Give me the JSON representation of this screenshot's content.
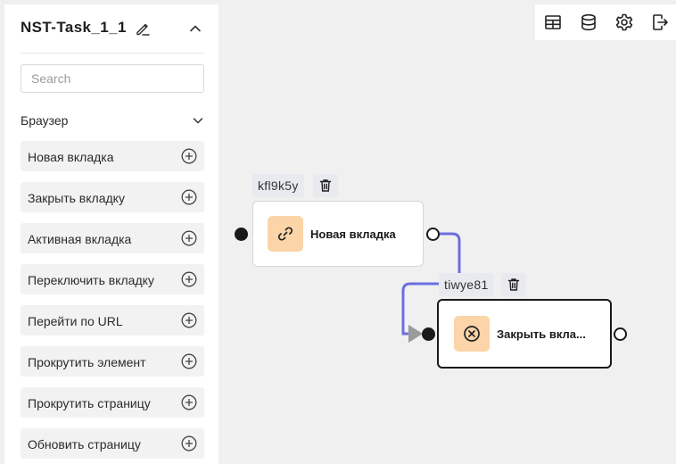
{
  "sidebar": {
    "title": "NST-Task_1_1",
    "search_placeholder": "Search",
    "category": "Браузер",
    "items": [
      {
        "label": "Новая вкладка"
      },
      {
        "label": "Закрыть вкладку"
      },
      {
        "label": "Активная вкладка"
      },
      {
        "label": "Переключить вкладку"
      },
      {
        "label": "Перейти по URL"
      },
      {
        "label": "Прокрутить элемент"
      },
      {
        "label": "Прокрутить страницу"
      },
      {
        "label": "Обновить страницу"
      }
    ]
  },
  "toolbar": {
    "icons": [
      "table-icon",
      "database-icon",
      "settings-icon",
      "logout-icon"
    ]
  },
  "canvas": {
    "nodes": [
      {
        "id": "kfl9k5y",
        "label": "Новая вкладка",
        "icon": "link-icon",
        "selected": false
      },
      {
        "id": "tiwye81",
        "label": "Закрыть вкла...",
        "icon": "close-circle-icon",
        "selected": true
      }
    ],
    "edge_color": "#6b6fe0",
    "node_icon_bg": "#fbd4a8"
  }
}
